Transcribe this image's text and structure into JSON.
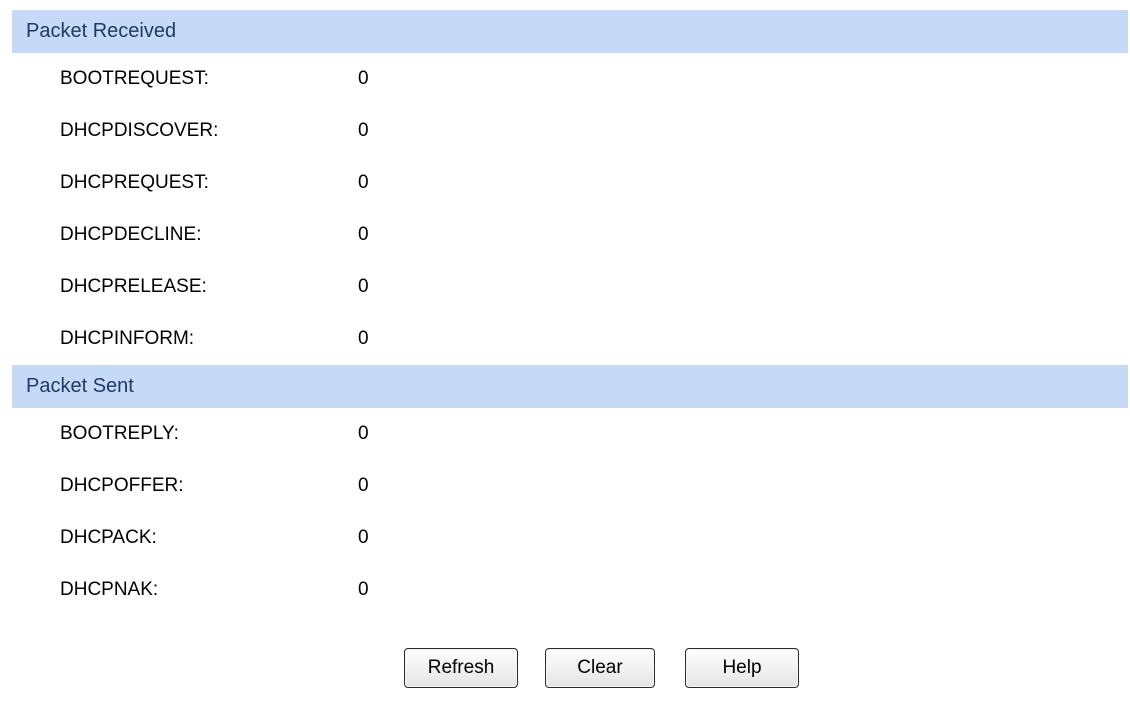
{
  "received": {
    "title": "Packet Received",
    "rows": [
      {
        "label": "BOOTREQUEST:",
        "value": "0"
      },
      {
        "label": "DHCPDISCOVER:",
        "value": "0"
      },
      {
        "label": "DHCPREQUEST:",
        "value": "0"
      },
      {
        "label": "DHCPDECLINE:",
        "value": "0"
      },
      {
        "label": "DHCPRELEASE:",
        "value": "0"
      },
      {
        "label": "DHCPINFORM:",
        "value": "0"
      }
    ]
  },
  "sent": {
    "title": "Packet Sent",
    "rows": [
      {
        "label": "BOOTREPLY:",
        "value": "0"
      },
      {
        "label": "DHCPOFFER:",
        "value": "0"
      },
      {
        "label": "DHCPACK:",
        "value": "0"
      },
      {
        "label": "DHCPNAK:",
        "value": "0"
      }
    ]
  },
  "buttons": {
    "refresh": "Refresh",
    "clear": "Clear",
    "help": "Help"
  },
  "colors": {
    "header_bg": "#c6d9f7",
    "header_text": "#1f3a66"
  }
}
